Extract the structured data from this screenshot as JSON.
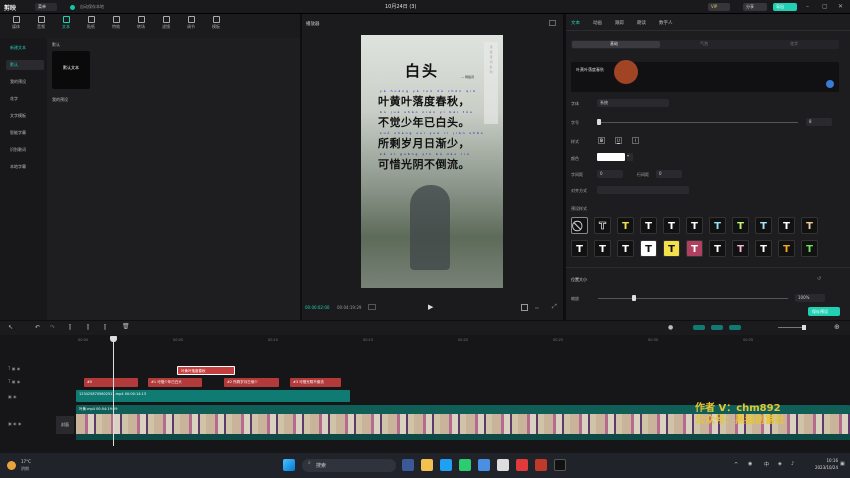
{
  "app": {
    "logo": "剪映",
    "menu_label": "菜单",
    "status": "自动保存本地",
    "doc_title": "10月24日 (3)",
    "vip_label": "VIP",
    "share_label": "分享",
    "export_label": "导出"
  },
  "toolbar": {
    "tools": [
      {
        "label": "媒体",
        "icon": "media-icon"
      },
      {
        "label": "音频",
        "icon": "audio-icon"
      },
      {
        "label": "文本",
        "icon": "text-icon"
      },
      {
        "label": "贴纸",
        "icon": "sticker-icon"
      },
      {
        "label": "特效",
        "icon": "effects-icon"
      },
      {
        "label": "转场",
        "icon": "transition-icon"
      },
      {
        "label": "滤镜",
        "icon": "filter-icon"
      },
      {
        "label": "调节",
        "icon": "adjust-icon"
      },
      {
        "label": "模板",
        "icon": "template-icon"
      }
    ],
    "active": "文本"
  },
  "sidebar": {
    "items": [
      "新建文本",
      "默认",
      "我的预设",
      "花字",
      "文字模板",
      "智能字幕",
      "识别歌词",
      "本地字幕"
    ],
    "selected": "默认"
  },
  "presets": {
    "heading": "默认",
    "card_label": "默认文本",
    "my_presets": "我的预设"
  },
  "player": {
    "title": "播放器",
    "current_time": "00:00:02:00",
    "total_time": "00:04:19:29"
  },
  "poem": {
    "title": "白头",
    "author": "— 网络诗",
    "lines": [
      "叶黄叶落度春秋，",
      "不觉少年已白头。",
      "所剩岁月日渐少，",
      "可惜光阴不倒流。"
    ],
    "pinyin": [
      "yè huáng yè luò dù chūn qiū",
      "bù jué shào nián yǐ bái tóu",
      "suǒ shèng suì yuè rì jiàn shǎo",
      "kě xī guāng yīn bù dào liú"
    ]
  },
  "right_panel": {
    "tabs": [
      "文本",
      "动画",
      "跟踪",
      "朗读",
      "数字人"
    ],
    "active_tab": "文本",
    "subtabs": [
      "基础",
      "气泡",
      "花字"
    ],
    "active_subtab": "基础",
    "text_value": "叶黄叶落度春秋",
    "labels": {
      "font": "字体",
      "size": "字号",
      "style": "样式",
      "color": "颜色",
      "spacing": "字间距",
      "line_spacing": "行间距",
      "align": "对齐方式",
      "preset_style": "预设样式",
      "position_size": "位置大小",
      "scale": "缩放",
      "save_preset": "保存预设"
    },
    "font_value": "系统",
    "size_value": "8",
    "spacing_value": "0",
    "line_spacing_value": "0",
    "scale_value": "100%",
    "style_buttons": [
      "B",
      "U",
      "I"
    ]
  },
  "timeline": {
    "ruler_ticks": [
      "00:00",
      "00:05",
      "00:10",
      "00:15",
      "00:20",
      "00:25",
      "00:30",
      "00:35"
    ],
    "text_clip": "叶黄叶落度春秋",
    "subtitle_clips": [
      "#0",
      "#1 可惜少年已白头",
      "#2 所剩岁月日渐少",
      "#3 可惜光阴不倒流"
    ],
    "audio_clip": "1234258705602511.mp4  00:00:14:13",
    "video_clip": "叶黄.mp4  00:04:19:29",
    "cover_label": "封面"
  },
  "watermark": {
    "line1": "作者 V：chm892",
    "line2": "公众号：黑猫创富社"
  },
  "taskbar": {
    "weather_temp": "17°C",
    "weather_text": "阴朗",
    "search_placeholder": "搜索",
    "time": "10:16",
    "date": "2023/10/24",
    "lang": "中"
  },
  "colors": {
    "accent": "#21d0b2",
    "clip_red": "#b33a3a",
    "clip_teal": "#0f7b73",
    "text_clip": "#c44040"
  }
}
